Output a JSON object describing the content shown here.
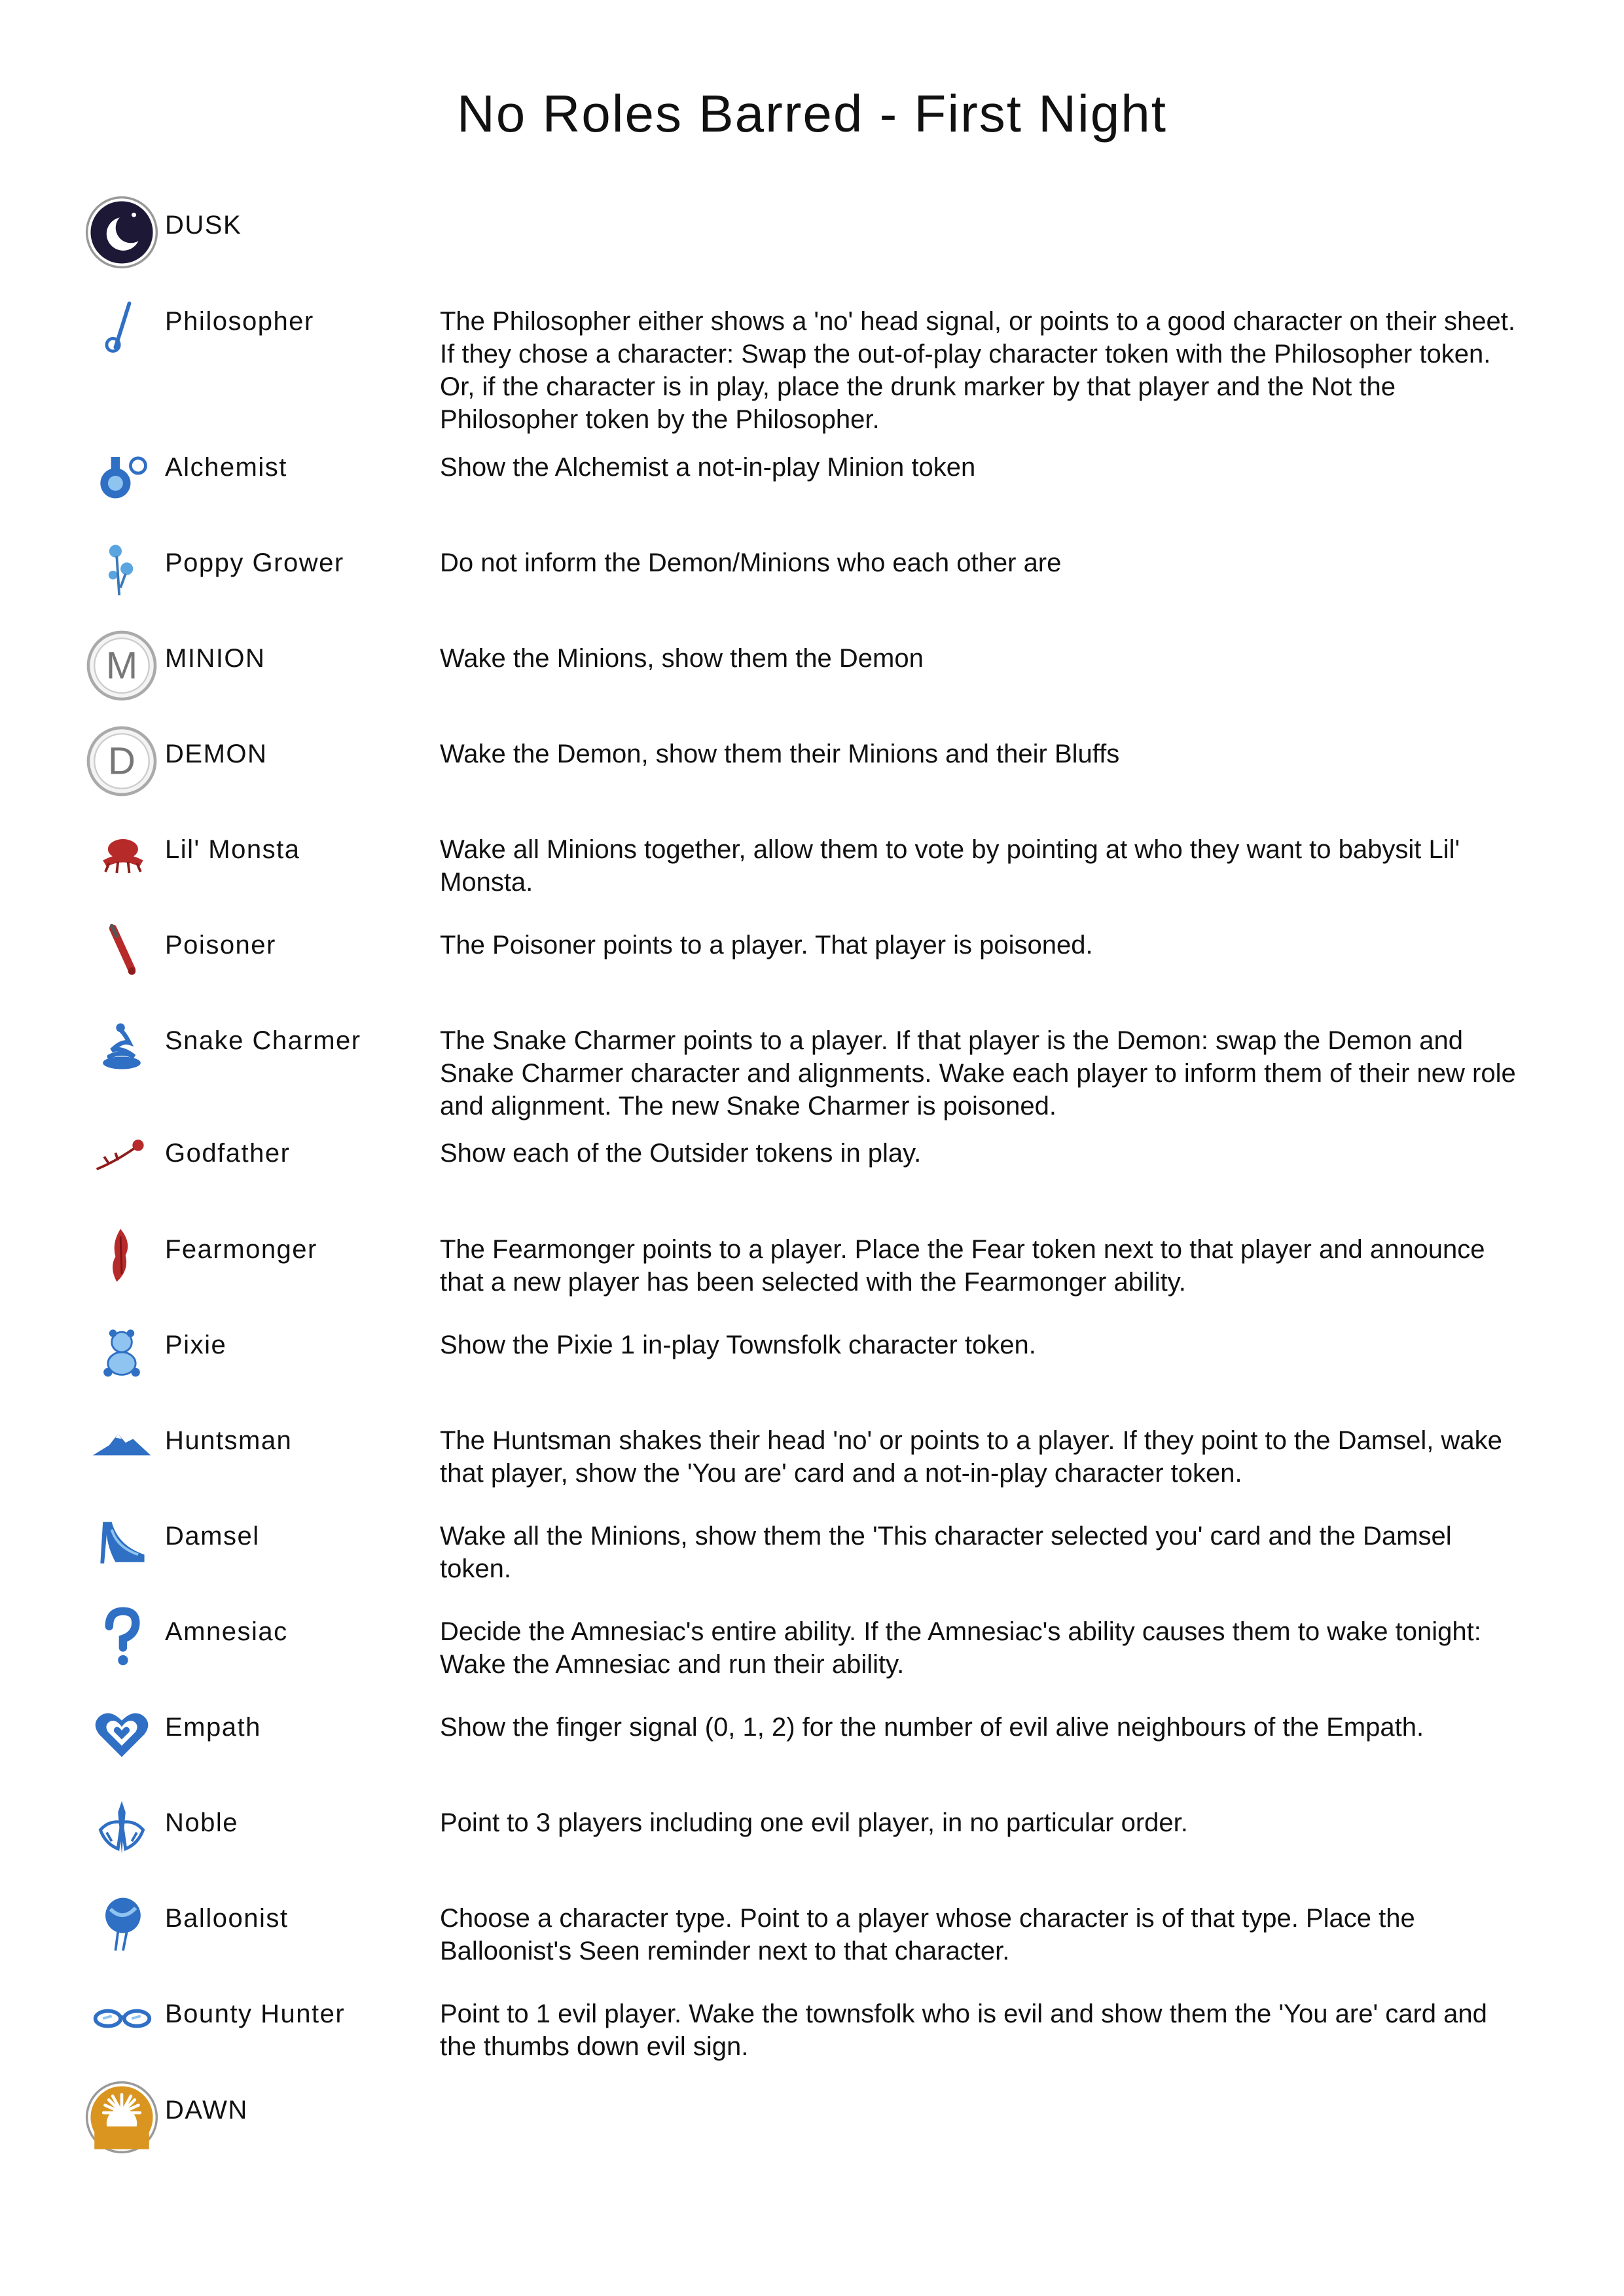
{
  "title": "No Roles Barred - First Night",
  "rows": [
    {
      "name": "DUSK",
      "desc": "",
      "icon": "dusk-moon-icon",
      "color": "#1d1836"
    },
    {
      "name": "Philosopher",
      "desc": "The Philosopher either shows a 'no' head signal, or points to a good character on their sheet. If they chose a character: Swap the out-of-play character token with the Philosopher token. Or, if the character is in play, place the drunk marker by that player and the Not the Philosopher token by the Philosopher.",
      "icon": "philosopher-staff-icon",
      "color": "#2f6fc4"
    },
    {
      "name": "Alchemist",
      "desc": "Show the Alchemist a not-in-play Minion token",
      "icon": "alchemist-flask-icon",
      "color": "#2f6fc4"
    },
    {
      "name": "Poppy Grower",
      "desc": "Do not inform the Demon/Minions who each other are",
      "icon": "poppy-flower-icon",
      "color": "#5aa5e0"
    },
    {
      "name": "MINION",
      "desc": "Wake the Minions, show them the Demon",
      "icon": "minion-m-icon",
      "color": "#777777"
    },
    {
      "name": "DEMON",
      "desc": "Wake the Demon, show them their Minions and their Bluffs",
      "icon": "demon-d-icon",
      "color": "#777777"
    },
    {
      "name": "Lil' Monsta",
      "desc": "Wake all Minions together, allow them to vote by pointing at who they want to babysit Lil' Monsta.",
      "icon": "lil-monsta-icon",
      "color": "#b72a2a"
    },
    {
      "name": "Poisoner",
      "desc": "The Poisoner points to a player. That player is poisoned.",
      "icon": "poisoner-vial-icon",
      "color": "#b72a2a"
    },
    {
      "name": "Snake Charmer",
      "desc": "The Snake Charmer points to a player. If that player is the Demon: swap the Demon and Snake Charmer character and alignments. Wake each player to inform them of their new role and alignment. The new Snake Charmer is poisoned.",
      "icon": "snake-charmer-icon",
      "color": "#2f6fc4"
    },
    {
      "name": "Godfather",
      "desc": "Show each of the Outsider tokens in play.",
      "icon": "godfather-rose-icon",
      "color": "#b72a2a"
    },
    {
      "name": "Fearmonger",
      "desc": "The Fearmonger points to a player. Place the Fear token next to that player and announce that a new player has been selected with the Fearmonger ability.",
      "icon": "fearmonger-icon",
      "color": "#b72a2a"
    },
    {
      "name": "Pixie",
      "desc": "Show the Pixie 1 in-play Townsfolk character token.",
      "icon": "pixie-bear-icon",
      "color": "#2f6fc4"
    },
    {
      "name": "Huntsman",
      "desc": "The Huntsman shakes their head 'no' or points to a player. If they point to the Damsel, wake that player, show the 'You are' card and a not-in-play character token.",
      "icon": "huntsman-mountain-icon",
      "color": "#2f6fc4"
    },
    {
      "name": "Damsel",
      "desc": "Wake all the Minions, show them the 'This character selected you' card and the Damsel token.",
      "icon": "damsel-slipper-icon",
      "color": "#2f6fc4"
    },
    {
      "name": "Amnesiac",
      "desc": "Decide the Amnesiac's entire ability. If the Amnesiac's ability causes them to wake tonight: Wake the Amnesiac and run their ability.",
      "icon": "amnesiac-question-icon",
      "color": "#2f6fc4"
    },
    {
      "name": "Empath",
      "desc": "Show the finger signal (0, 1, 2) for the number of evil alive neighbours of the Empath.",
      "icon": "empath-heart-icon",
      "color": "#2f6fc4"
    },
    {
      "name": "Noble",
      "desc": "Point to 3 players including one evil player, in no particular order.",
      "icon": "noble-crest-icon",
      "color": "#2f6fc4"
    },
    {
      "name": "Balloonist",
      "desc": "Choose a character type. Point to a player whose character is of that type. Place the Balloonist's Seen reminder next to that character.",
      "icon": "balloonist-balloon-icon",
      "color": "#2f6fc4"
    },
    {
      "name": "Bounty Hunter",
      "desc": "Point to 1 evil player. Wake the townsfolk who is evil and show them the 'You are' card and the thumbs down evil sign.",
      "icon": "bounty-hunter-glasses-icon",
      "color": "#2f6fc4"
    },
    {
      "name": "DAWN",
      "desc": "",
      "icon": "dawn-sun-icon",
      "color": "#d9951f"
    }
  ]
}
